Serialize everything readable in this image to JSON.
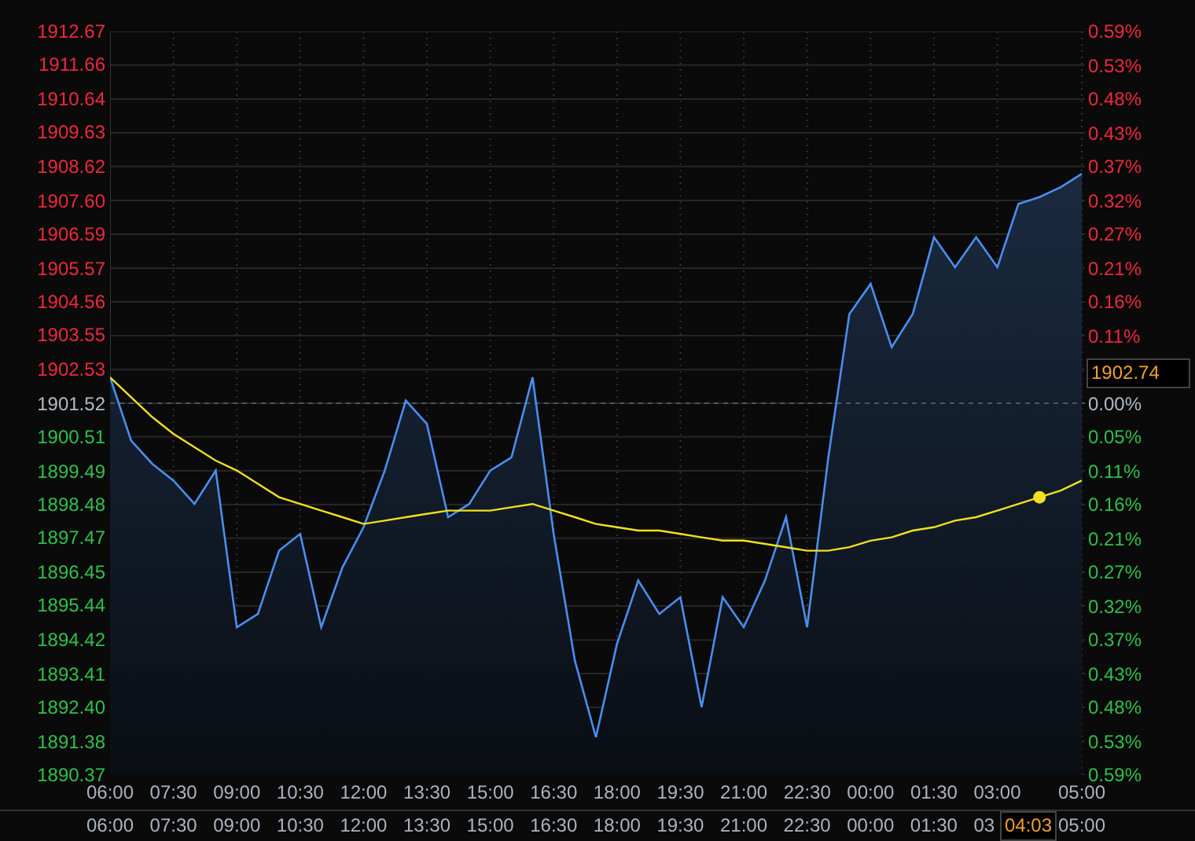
{
  "right_axis": [
    {
      "text": "0.59%",
      "kind": "up"
    },
    {
      "text": "0.53%",
      "kind": "up"
    },
    {
      "text": "0.48%",
      "kind": "up"
    },
    {
      "text": "0.43%",
      "kind": "up"
    },
    {
      "text": "0.37%",
      "kind": "up"
    },
    {
      "text": "0.32%",
      "kind": "up"
    },
    {
      "text": "0.27%",
      "kind": "up"
    },
    {
      "text": "0.21%",
      "kind": "up"
    },
    {
      "text": "0.16%",
      "kind": "up"
    },
    {
      "text": "0.11%",
      "kind": "up"
    },
    {
      "text": "1902.74",
      "kind": "cursor"
    },
    {
      "text": "0.00%",
      "kind": "flat"
    },
    {
      "text": "0.05%",
      "kind": "down"
    },
    {
      "text": "0.11%",
      "kind": "down"
    },
    {
      "text": "0.16%",
      "kind": "down"
    },
    {
      "text": "0.21%",
      "kind": "down"
    },
    {
      "text": "0.27%",
      "kind": "down"
    },
    {
      "text": "0.32%",
      "kind": "down"
    },
    {
      "text": "0.37%",
      "kind": "down"
    },
    {
      "text": "0.43%",
      "kind": "down"
    },
    {
      "text": "0.48%",
      "kind": "down"
    },
    {
      "text": "0.53%",
      "kind": "down"
    },
    {
      "text": "0.59%",
      "kind": "down"
    }
  ],
  "time_axis_2": [
    "06:00",
    "07:30",
    "09:00",
    "10:30",
    "12:00",
    "13:30",
    "15:00",
    "16:30",
    "18:00",
    "19:30",
    "21:00",
    "22:30",
    "00:00",
    "01:30",
    "03",
    "05:00"
  ],
  "cursor_time": "04:03",
  "chart_data": {
    "type": "area",
    "grid": true,
    "ylim": [
      1890.37,
      1912.67
    ],
    "categories": [
      "06:00",
      null,
      null,
      "07:30",
      null,
      null,
      "09:00",
      null,
      null,
      "10:30",
      null,
      null,
      "12:00",
      null,
      null,
      "13:30",
      null,
      null,
      "15:00",
      null,
      null,
      "16:30",
      null,
      null,
      "18:00",
      null,
      null,
      "19:30",
      null,
      null,
      "21:00",
      null,
      null,
      "22:30",
      null,
      null,
      "00:00",
      null,
      null,
      "01:30",
      null,
      null,
      "03:00",
      null,
      null,
      null,
      "05:00"
    ],
    "yticks": [
      {
        "value": 1912.67,
        "label": "1912.67"
      },
      {
        "value": 1911.66,
        "label": "1911.66"
      },
      {
        "value": 1910.64,
        "label": "1910.64"
      },
      {
        "value": 1909.63,
        "label": "1909.63"
      },
      {
        "value": 1908.62,
        "label": "1908.62"
      },
      {
        "value": 1907.6,
        "label": "1907.60"
      },
      {
        "value": 1906.59,
        "label": "1906.59"
      },
      {
        "value": 1905.57,
        "label": "1905.57"
      },
      {
        "value": 1904.56,
        "label": "1904.56"
      },
      {
        "value": 1903.55,
        "label": "1903.55"
      },
      {
        "value": 1902.53,
        "label": "1902.53"
      },
      {
        "value": 1901.52,
        "label": "1901.52"
      },
      {
        "value": 1900.51,
        "label": "1900.51"
      },
      {
        "value": 1899.49,
        "label": "1899.49"
      },
      {
        "value": 1898.48,
        "label": "1898.48"
      },
      {
        "value": 1897.47,
        "label": "1897.47"
      },
      {
        "value": 1896.45,
        "label": "1896.45"
      },
      {
        "value": 1895.44,
        "label": "1895.44"
      },
      {
        "value": 1894.42,
        "label": "1894.42"
      },
      {
        "value": 1893.41,
        "label": "1893.41"
      },
      {
        "value": 1892.4,
        "label": "1892.40"
      },
      {
        "value": 1891.38,
        "label": "1891.38"
      },
      {
        "value": 1890.37,
        "label": "1890.37"
      }
    ],
    "ref_lines": [
      {
        "axis": "y",
        "value": 1901.52
      }
    ],
    "series": [
      {
        "color": "#4a8ef0",
        "values": [
          1902.3,
          1900.4,
          1899.7,
          1899.2,
          1898.5,
          1899.5,
          1894.8,
          1895.2,
          1897.1,
          1897.6,
          1894.8,
          1896.6,
          1897.8,
          1899.5,
          1901.6,
          1900.9,
          1898.1,
          1898.5,
          1899.5,
          1899.9,
          1902.3,
          1897.6,
          1893.8,
          1891.5,
          1894.3,
          1896.2,
          1895.2,
          1895.7,
          1892.4,
          1895.7,
          1894.8,
          1896.2,
          1898.1,
          1894.8,
          1899.9,
          1904.2,
          1905.1,
          1903.2,
          1904.2,
          1906.5,
          1905.6,
          1906.5,
          1905.6,
          1907.5,
          1907.7,
          1908.0,
          1908.4
        ]
      },
      {
        "color": "#f0e020",
        "type": "line",
        "values": [
          1902.3,
          1901.7,
          1901.1,
          1900.6,
          1900.2,
          1899.8,
          1899.5,
          1899.1,
          1898.7,
          1898.5,
          1898.3,
          1898.1,
          1897.9,
          1898.0,
          1898.1,
          1898.2,
          1898.3,
          1898.3,
          1898.3,
          1898.4,
          1898.5,
          1898.3,
          1898.1,
          1897.9,
          1897.8,
          1897.7,
          1897.7,
          1897.6,
          1897.5,
          1897.4,
          1897.4,
          1897.3,
          1897.2,
          1897.1,
          1897.1,
          1897.2,
          1897.4,
          1897.5,
          1897.7,
          1897.8,
          1898.0,
          1898.1,
          1898.3,
          1898.5,
          1898.7,
          1898.9,
          1899.2
        ]
      },
      {
        "color": "#f0e020",
        "type": "scatter",
        "values": [
          null,
          null,
          null,
          null,
          null,
          null,
          null,
          null,
          null,
          null,
          null,
          null,
          null,
          null,
          null,
          null,
          null,
          null,
          null,
          null,
          null,
          null,
          null,
          null,
          null,
          null,
          null,
          null,
          null,
          null,
          null,
          null,
          null,
          null,
          null,
          null,
          null,
          null,
          null,
          null,
          null,
          null,
          null,
          null,
          1898.7,
          null,
          null
        ]
      }
    ]
  }
}
